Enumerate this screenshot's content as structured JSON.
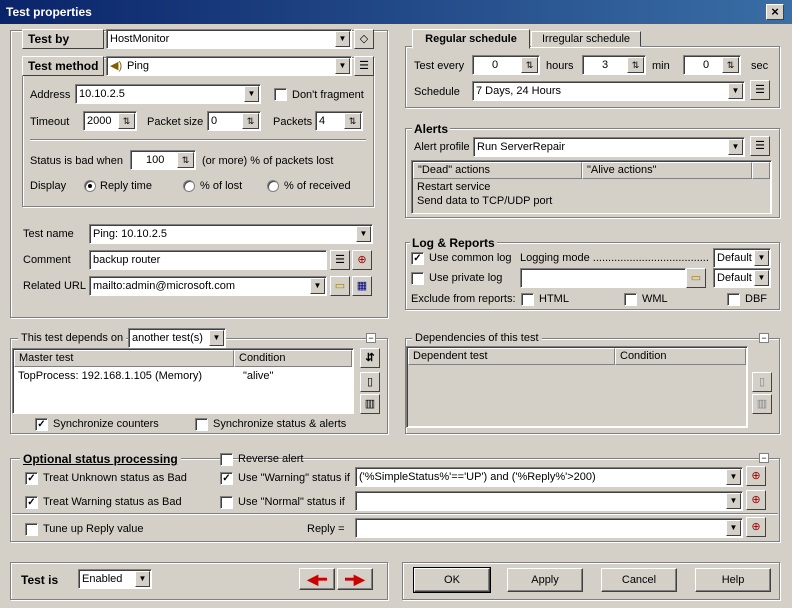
{
  "window": {
    "title": "Test properties",
    "close": "×"
  },
  "test_by": {
    "label": "Test by",
    "value": "HostMonitor"
  },
  "test_method": {
    "label": "Test method",
    "value": "Ping"
  },
  "ping": {
    "address_label": "Address",
    "address": "10.10.2.5",
    "dont_fragment": "Don't fragment",
    "timeout_label": "Timeout",
    "timeout": "2000",
    "packet_size_label": "Packet size",
    "packet_size": "0",
    "packets_label": "Packets",
    "packets": "4",
    "status_bad_label": "Status is bad when",
    "status_bad": "100",
    "status_bad_suffix": "(or more) % of packets lost",
    "display_label": "Display",
    "display_options": [
      "Reply time",
      "% of lost",
      "% of received"
    ]
  },
  "info": {
    "test_name_label": "Test name",
    "test_name": "Ping: 10.10.2.5",
    "comment_label": "Comment",
    "comment": "backup router",
    "url_label": "Related URL",
    "url": "mailto:admin@microsoft.com"
  },
  "schedule": {
    "tab_regular": "Regular schedule",
    "tab_irregular": "Irregular schedule",
    "test_every_label": "Test every",
    "hours": "0",
    "hours_label": "hours",
    "min": "3",
    "min_label": "min",
    "sec": "0",
    "sec_label": "sec",
    "schedule_label": "Schedule",
    "schedule": "7 Days, 24 Hours"
  },
  "alerts": {
    "title": "Alerts",
    "profile_label": "Alert profile",
    "profile": "Run ServerRepair",
    "col_dead": "\"Dead\" actions",
    "col_alive": "\"Alive actions\"",
    "actions": [
      "Restart service",
      "Send data to TCP/UDP port"
    ]
  },
  "log": {
    "title": "Log & Reports",
    "use_common": "Use common log",
    "logging_mode": "Logging mode ......................................",
    "mode1": "Default",
    "use_private": "Use private log",
    "mode2": "Default",
    "exclude_label": "Exclude from reports:",
    "html": "HTML",
    "wml": "WML",
    "dbf": "DBF"
  },
  "depends": {
    "title": "This test depends on",
    "value": "another test(s)",
    "col_master": "Master test",
    "col_condition": "Condition",
    "rows": [
      {
        "master": "TopProcess: 192.168.1.105 (Memory)",
        "condition": "\"alive\""
      }
    ],
    "sync_counters": "Synchronize counters",
    "sync_status": "Synchronize status & alerts"
  },
  "dependencies": {
    "title": "Dependencies of this test",
    "col_dependent": "Dependent test",
    "col_condition": "Condition"
  },
  "optional": {
    "title": "Optional status processing",
    "unknown_bad": "Treat Unknown status as Bad",
    "warning_bad": "Treat Warning status as Bad",
    "reverse_alert": "Reverse alert",
    "use_warning": "Use \"Warning\" status if",
    "warning_expr": "('%SimpleStatus%'=='UP') and ('%Reply%'>200)",
    "use_normal": "Use \"Normal\" status if",
    "normal_expr": "",
    "tune_reply": "Tune up Reply value",
    "reply_label": "Reply =",
    "reply_expr": ""
  },
  "footer": {
    "test_is_label": "Test is",
    "test_is": "Enabled",
    "ok": "OK",
    "apply": "Apply",
    "cancel": "Cancel",
    "help": "Help"
  },
  "colors": {
    "titlebar_start": "#0a246a",
    "titlebar_end": "#3a6ea5",
    "face": "#d4d0c8",
    "arrow": "#cc0000"
  },
  "icons": [
    "close-icon",
    "eraser-icon",
    "list-icon",
    "speaker-icon",
    "dropdown-arrow-icon",
    "spin-icon",
    "magnifier-icon",
    "folder-icon",
    "calendar-icon",
    "sort-icon",
    "new-doc-icon",
    "trash-icon",
    "arrow-left-icon",
    "arrow-right-icon",
    "collapse-icon"
  ]
}
